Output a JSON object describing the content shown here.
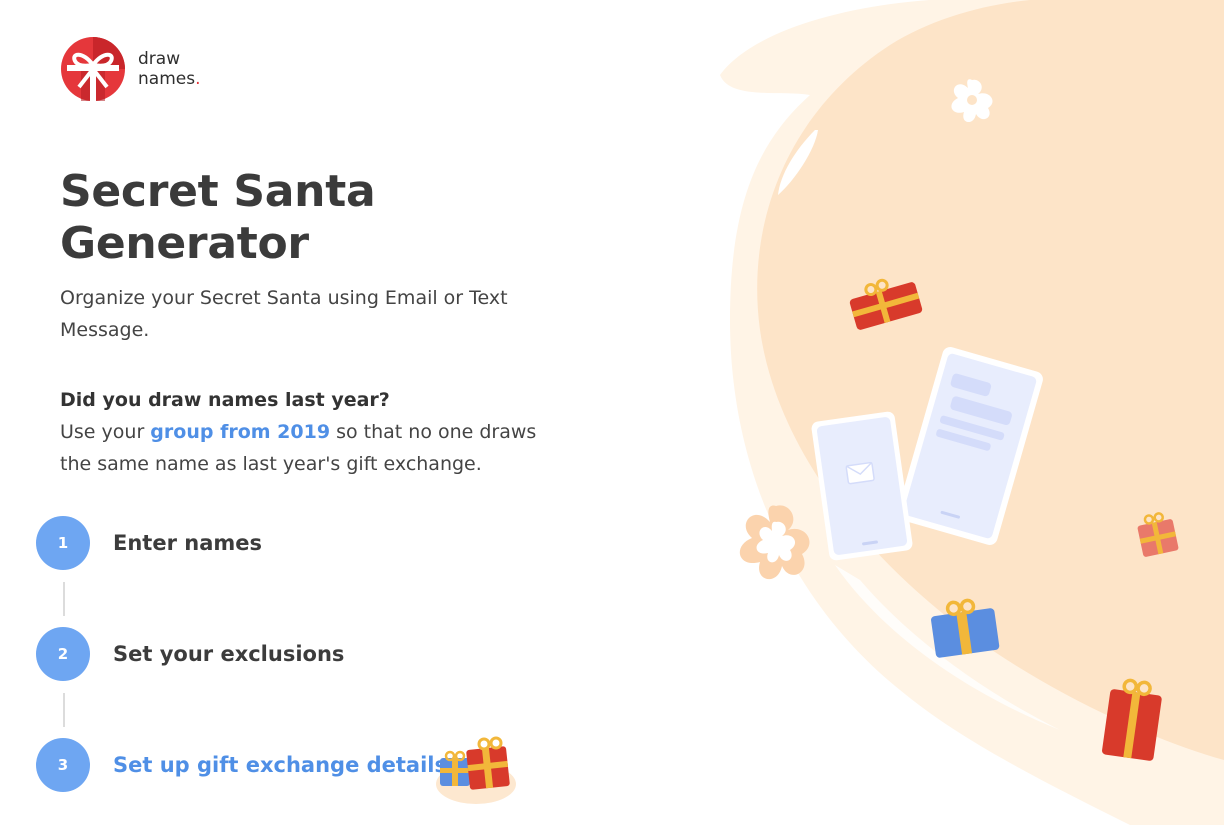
{
  "logo": {
    "line1": "draw",
    "line2": "names",
    "dot": "."
  },
  "hero": {
    "title_line1": "Secret Santa",
    "title_line2": "Generator",
    "subtitle": "Organize your Secret Santa using Email or Text Message."
  },
  "prompt": {
    "question": "Did you draw names last year?",
    "text_before": "Use your ",
    "link": "group from 2019",
    "text_after": " so that no one draws the same name as last year's gift exchange."
  },
  "steps": [
    {
      "number": "1",
      "label": "Enter names"
    },
    {
      "number": "2",
      "label": "Set your exclusions"
    },
    {
      "number": "3",
      "label": "Set up gift exchange details"
    }
  ],
  "colors": {
    "accent": "#4f8fe6",
    "step_circle": "#6ea6f2",
    "brand_red": "#e5373b",
    "illustration_bg": "#fde8d0"
  },
  "icons": {
    "logo": "gift-bow-logo-icon",
    "illustration": "gifts-and-phones-illustration",
    "small_gifts": "gift-boxes-icon"
  }
}
